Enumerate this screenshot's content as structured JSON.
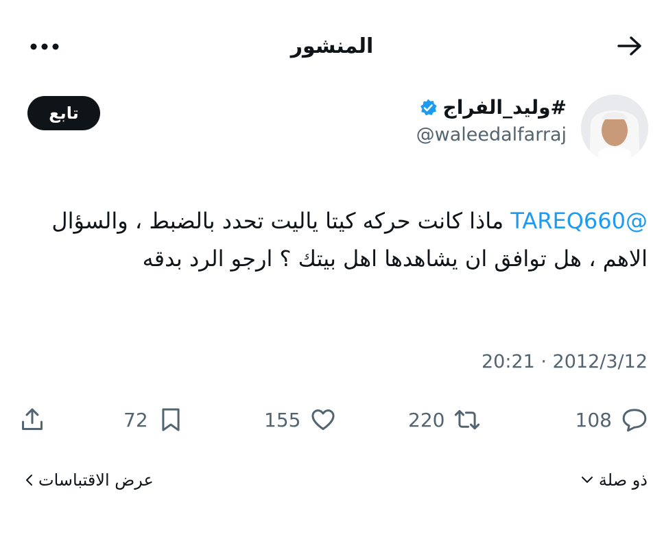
{
  "header": {
    "title": "المنشور",
    "back_icon": "arrow-right-icon",
    "more_icon": "more-horizontal-icon"
  },
  "author": {
    "name": "#وليد_الفراج",
    "handle": "@waleedalfarraj",
    "verified": true,
    "verified_color": "#1d9bf0"
  },
  "follow": {
    "label": "تابع"
  },
  "tweet": {
    "mention": "@TAREQ660",
    "text": "ماذا كانت حركه كيتا ياليت تحدد بالضبط ، والسؤال الاهم ، هل توافق ان يشاهدها اهل بيتك ؟ ارجو الرد بدقه",
    "timestamp": "20:21 · 2012/3/12"
  },
  "actions": {
    "replies": "108",
    "retweets": "220",
    "likes": "155",
    "bookmarks": "72"
  },
  "links": {
    "relevance": "ذو صلة",
    "quotes": "عرض الاقتباسات"
  },
  "colors": {
    "text": "#0f1419",
    "secondary": "#536471",
    "accent": "#1d9bf0"
  }
}
